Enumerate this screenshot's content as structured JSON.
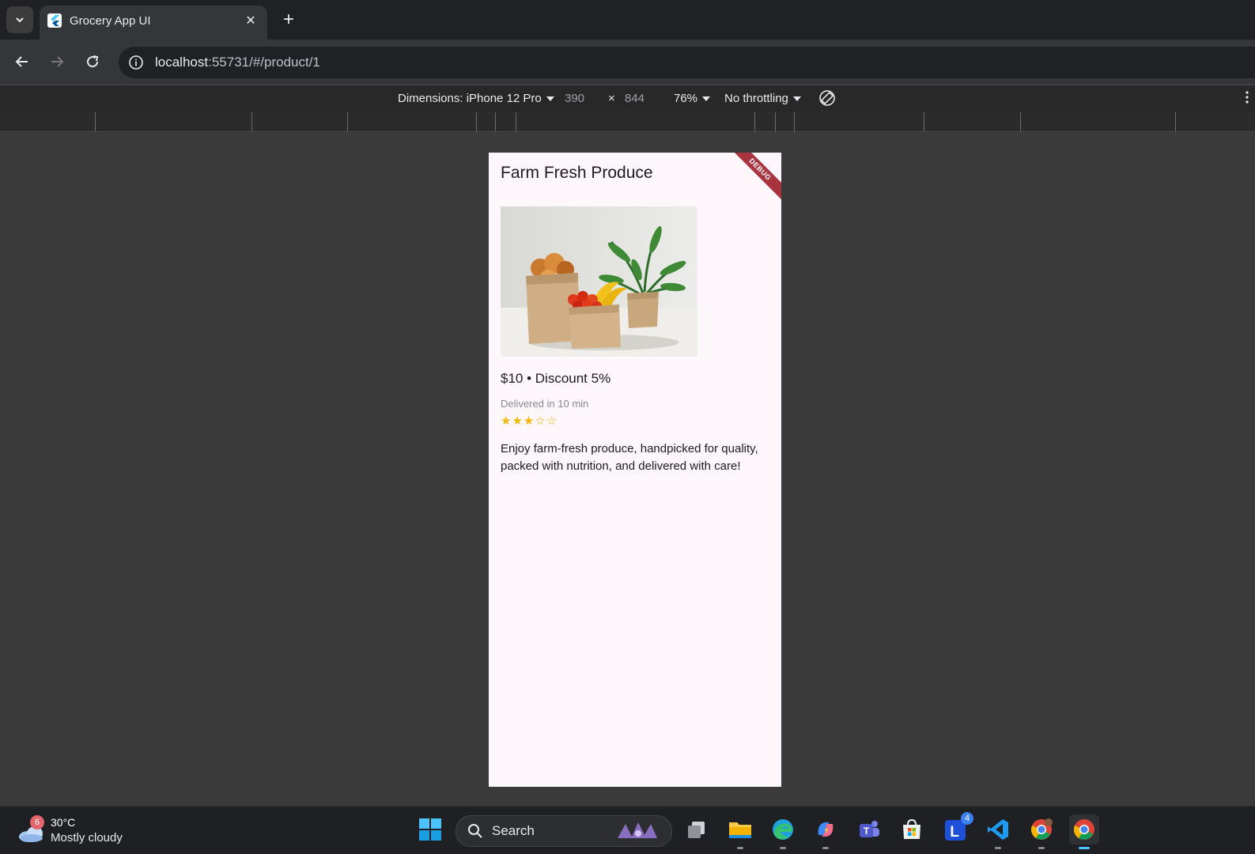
{
  "browser": {
    "tab_title": "Grocery App UI",
    "url_host": "localhost",
    "url_rest": ":55731/#/product/1"
  },
  "devtools": {
    "dimensions_label": "Dimensions: iPhone 12 Pro",
    "width": "390",
    "height": "844",
    "zoom": "76%",
    "throttling": "No throttling"
  },
  "app": {
    "title": "Farm Fresh Produce",
    "debug_label": "DEBUG",
    "price_line": "$10 • Discount 5%",
    "delivery": "Delivered in 10 min",
    "rating": 3,
    "rating_max": 5,
    "stars_text": "★★★☆☆",
    "description": "Enjoy farm-fresh produce, handpicked for quality, packed with nutrition, and delivered with care!"
  },
  "taskbar": {
    "weather_badge": "6",
    "temperature": "30°C",
    "condition": "Mostly cloudy",
    "search_label": "Search",
    "notification_badge": "4"
  },
  "colors": {
    "accent_star": "#f5b800",
    "app_background": "#fdf6fb",
    "debug_ribbon": "#a8343f"
  }
}
